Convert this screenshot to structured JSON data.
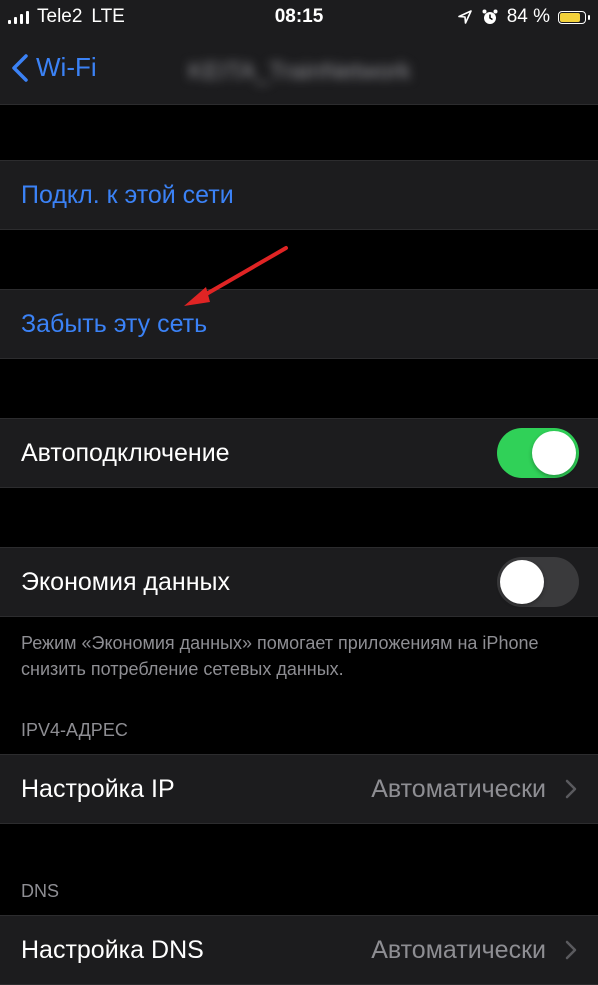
{
  "status_bar": {
    "carrier": "Tele2",
    "network": "LTE",
    "time": "08:15",
    "battery_percent": "84 %",
    "battery_level": 0.84,
    "icons": [
      "location-arrow-icon",
      "alarm-icon",
      "battery-icon",
      "signal-bars-icon"
    ]
  },
  "nav": {
    "back_label": "Wi-Fi",
    "network_name": "KEITA_TrainNetwork"
  },
  "rows": {
    "join": "Подкл. к этой сети",
    "forget": "Забыть эту сеть",
    "auto_join": "Автоподключение",
    "low_data": "Экономия данных",
    "configure_ip": "Настройка IP",
    "configure_ip_value": "Автоматически",
    "configure_dns": "Настройка DNS",
    "configure_dns_value": "Автоматически"
  },
  "toggles": {
    "auto_join_on": true,
    "low_data_on": false
  },
  "footnote": "Режим «Экономия данных» помогает приложениям на iPhone снизить потребление сетевых данных.",
  "sections": {
    "ipv4": "IPV4-АДРЕС",
    "dns": "DNS"
  },
  "colors": {
    "accent": "#3b82f6",
    "toggle_on": "#30d158",
    "annotation_arrow": "#e02424",
    "battery": "#f2d13b"
  }
}
